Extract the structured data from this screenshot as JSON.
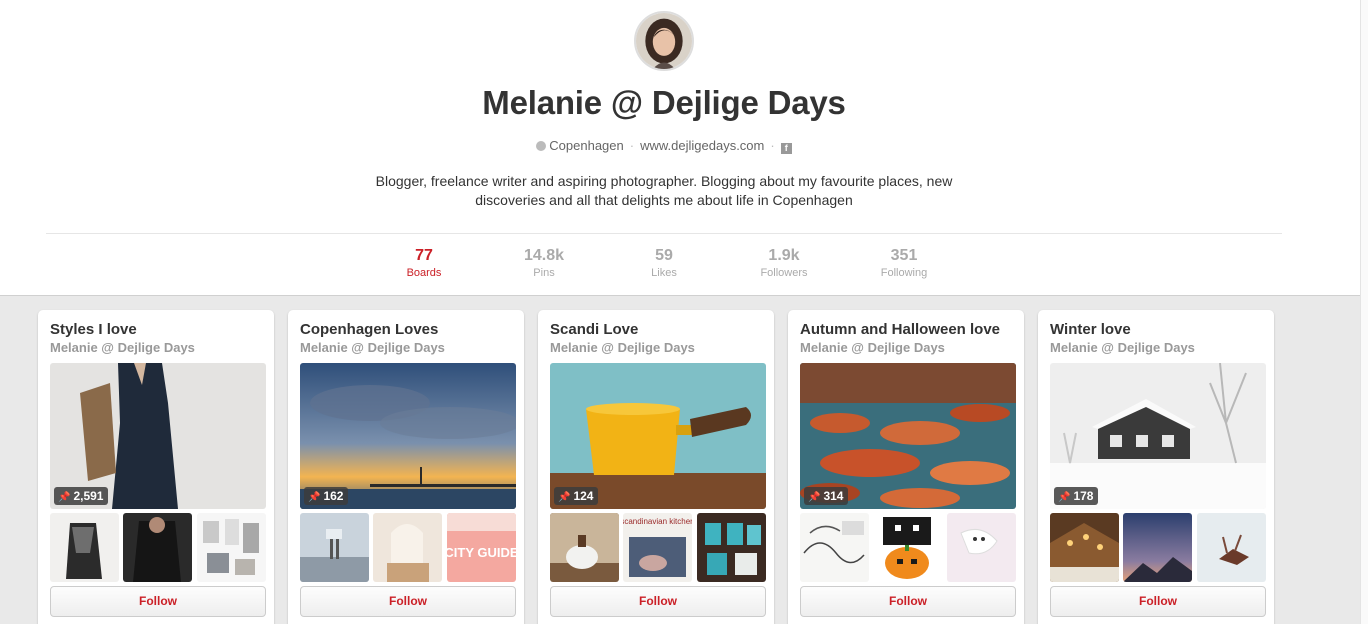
{
  "profile": {
    "name": "Melanie @ Dejlige Days",
    "location": "Copenhagen",
    "website": "www.dejligedays.com",
    "about": "Blogger, freelance writer and aspiring photographer. Blogging about my favourite places, new discoveries and all that delights me about life in Copenhagen"
  },
  "stats": [
    {
      "value": "77",
      "label": "Boards",
      "active": true
    },
    {
      "value": "14.8k",
      "label": "Pins",
      "active": false
    },
    {
      "value": "59",
      "label": "Likes",
      "active": false
    },
    {
      "value": "1.9k",
      "label": "Followers",
      "active": false
    },
    {
      "value": "351",
      "label": "Following",
      "active": false
    }
  ],
  "colors": {
    "accent": "#cb2027",
    "muted": "#aaaaaa"
  },
  "icons": {
    "location": "location-icon",
    "facebook": "facebook-icon",
    "pin": "pin-icon"
  },
  "boards": [
    {
      "title": "Styles I love",
      "owner": "Melanie @ Dejlige Days",
      "pin_count": "2,591",
      "follow_label": "Follow"
    },
    {
      "title": "Copenhagen Loves",
      "owner": "Melanie @ Dejlige Days",
      "pin_count": "162",
      "follow_label": "Follow",
      "thumb3_text": "CITY GUIDE"
    },
    {
      "title": "Scandi Love",
      "owner": "Melanie @ Dejlige Days",
      "pin_count": "124",
      "follow_label": "Follow",
      "thumb2_text": "scandinavian kitchen"
    },
    {
      "title": "Autumn and Halloween love",
      "owner": "Melanie @ Dejlige Days",
      "pin_count": "314",
      "follow_label": "Follow"
    },
    {
      "title": "Winter love",
      "owner": "Melanie @ Dejlige Days",
      "pin_count": "178",
      "follow_label": "Follow"
    }
  ]
}
